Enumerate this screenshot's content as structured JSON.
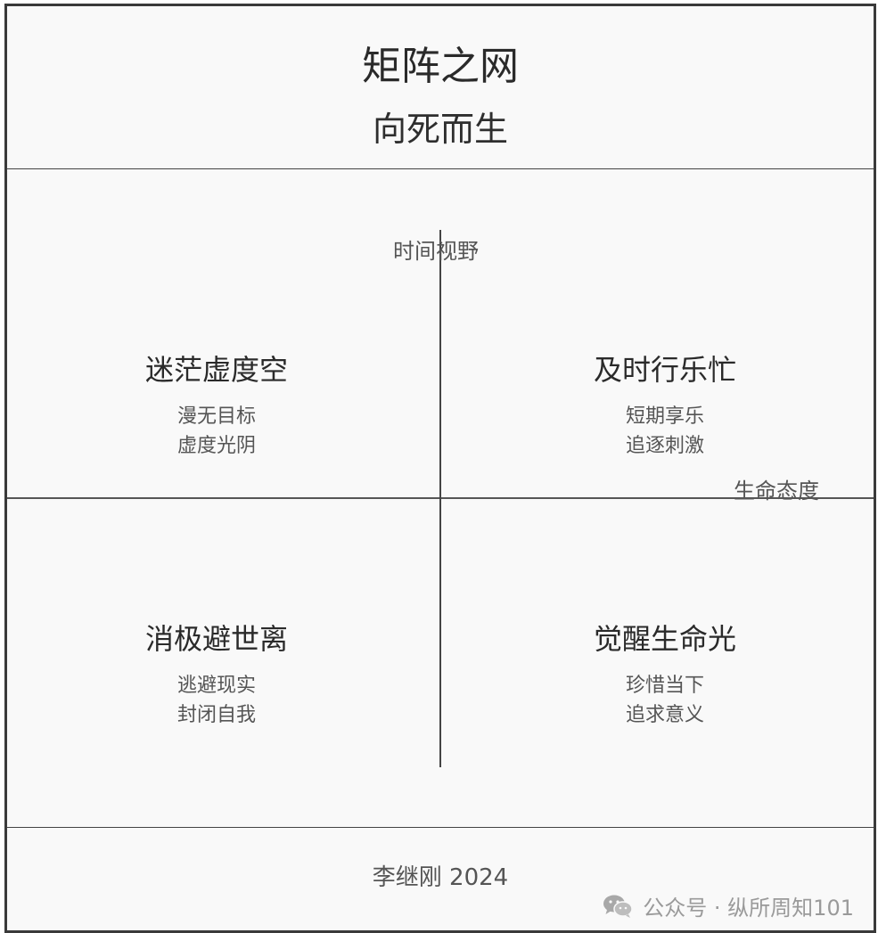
{
  "header": {
    "title": "矩阵之网",
    "subtitle": "向死而生"
  },
  "axes": {
    "vertical_label": "时间视野",
    "horizontal_label": "生命态度"
  },
  "quadrants": {
    "top_left": {
      "title": "迷茫虚度空",
      "lines": [
        "漫无目标",
        "虚度光阴"
      ]
    },
    "top_right": {
      "title": "及时行乐忙",
      "lines": [
        "短期享乐",
        "追逐刺激"
      ]
    },
    "bottom_left": {
      "title": "消极避世离",
      "lines": [
        "逃避现实",
        "封闭自我"
      ]
    },
    "bottom_right": {
      "title": "觉醒生命光",
      "lines": [
        "珍惜当下",
        "追求意义"
      ]
    }
  },
  "footer": {
    "author": "李继刚 2024",
    "watermark": "公众号 · 纵所周知101",
    "watermark_icon": "wechat-icon"
  }
}
